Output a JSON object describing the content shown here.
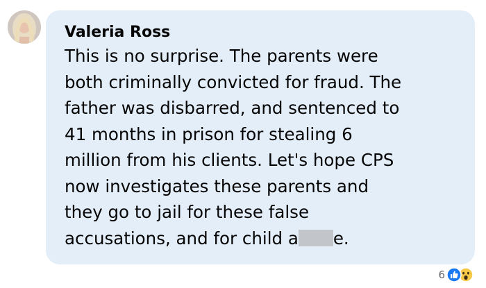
{
  "comment": {
    "author": "Valeria Ross",
    "lines": [
      "This is no surprise. The parents were",
      "both criminally convicted for fraud. The",
      "father was disbarred, and sentenced to",
      "41 months in prison for stealing 6",
      "million from his clients. Let's hope CPS",
      "now investigates these parents and",
      "they go to jail for these false"
    ],
    "last_line_before_redaction": "accusations, and for child a",
    "last_line_after_redaction": "e."
  },
  "reactions": {
    "count": "6",
    "icons": [
      "like-icon",
      "wow-icon"
    ]
  },
  "colors": {
    "bubble": "#e4eef9",
    "text": "#050505",
    "meta": "#65676b",
    "like": "#1877f2",
    "wow": "#f7c948",
    "redaction": "#c2c5ca"
  }
}
